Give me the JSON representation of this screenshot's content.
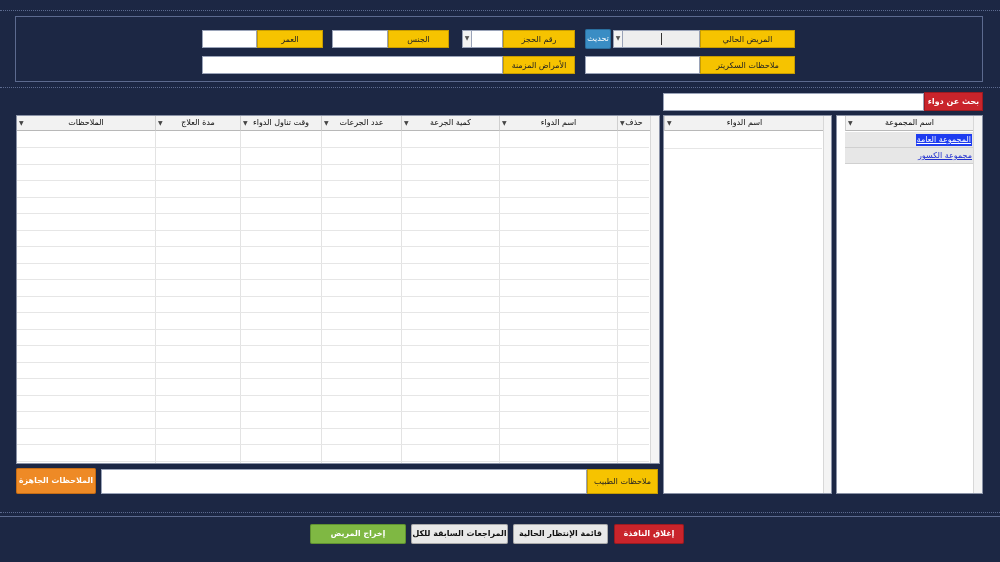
{
  "patient_form": {
    "current_patient_label": "المريض الحالي",
    "refresh_button": "تحديث",
    "booking_number_label": "رقم الحجز",
    "gender_label": "الجنس",
    "age_label": "العمر",
    "diabetes_notes_label": "ملاحظات السكريتر",
    "chronic_diseases_label": "الأمراض المزمنة"
  },
  "drug_search": {
    "button_label": "بحث عن دواء"
  },
  "groups_grid": {
    "header": "اسم المجموعة",
    "rows": [
      "المجموعة العامة",
      "مجموعة الكسور"
    ]
  },
  "drugs_grid": {
    "header": "اسم الدواء"
  },
  "prescription_grid": {
    "headers": [
      "حذف",
      "اسم الدواء",
      "كمية الجرعة",
      "عدد الجرعات",
      "وقت تناول الدواء",
      "مدة العلاج",
      "الملاحظات"
    ]
  },
  "doctor_notes": {
    "label": "ملاحظات الطبيب",
    "ready_notes_button": "الملاحظات الجاهزة"
  },
  "footer": {
    "close_button": "إغلاق النافذة",
    "waiting_list_button": "قائمة الإنتظار الحالية",
    "previous_visits_button": "المراجعات السابقة للكل",
    "discharge_button": "إخراج المريض"
  },
  "colors": {
    "background": "#1c2744",
    "label": "#f6c300",
    "refresh": "#3a8dc4",
    "search": "#c9242b",
    "ready_notes": "#ee8a26",
    "close": "#c9242b",
    "discharge": "#7fb843"
  }
}
